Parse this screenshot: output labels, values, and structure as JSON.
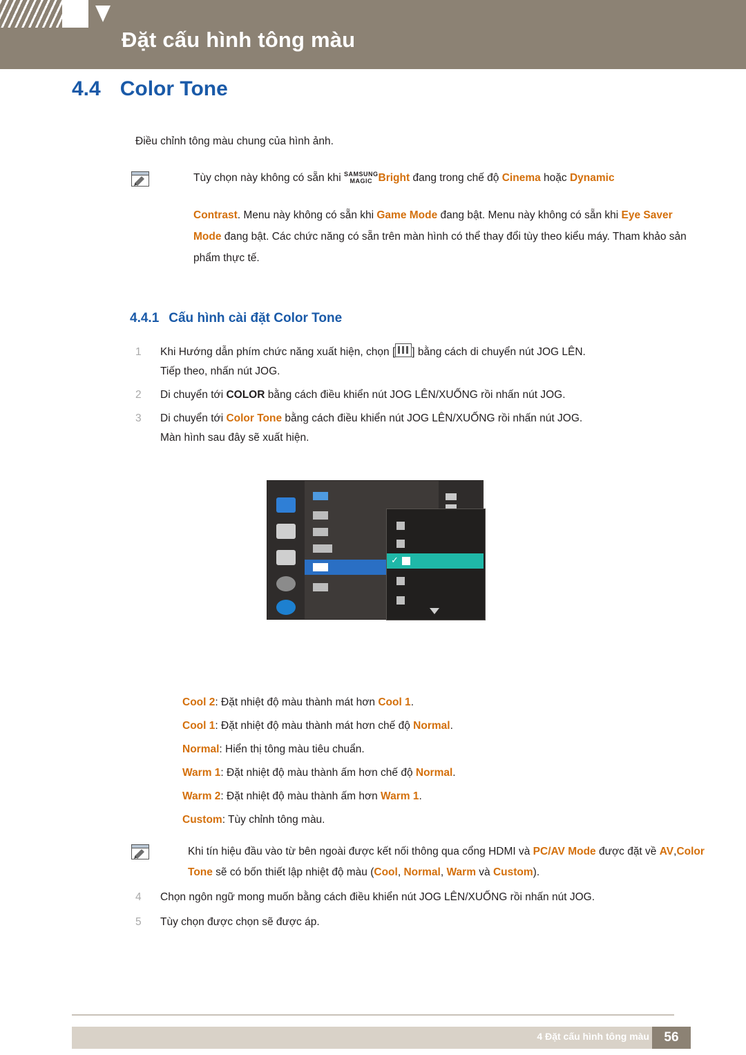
{
  "header": {
    "title": "Đặt cấu hình tông màu"
  },
  "section": {
    "number": "4.4",
    "title": "Color Tone",
    "intro": "Điều chỉnh tông màu chung của hình ảnh."
  },
  "note1": {
    "icon": "note-pencil-icon",
    "line1_a": "Tùy chọn này không có sẵn khi ",
    "magic_top": "SAMSUNG",
    "magic_bottom": "MAGIC",
    "line1_bright": "Bright",
    "line1_b": " đang trong chế độ ",
    "line1_cinema": "Cinema",
    "line1_c": " hoặc ",
    "line1_dynamic": "Dynamic",
    "line1_contrast": "Contrast",
    "line1_d": ".",
    "line2_a": "Menu này không có sẵn khi ",
    "line2_game": "Game Mode",
    "line2_b": " đang bật.",
    "line3_a": "Menu này không có sẵn khi ",
    "line3_eye": "Eye Saver Mode",
    "line3_b": " đang bật.",
    "line4": "Các chức năng có sẵn trên màn hình có thể thay đổi tùy theo kiểu máy. Tham khảo sản phẩm thực tế."
  },
  "subsection": {
    "number": "4.4.1",
    "title": "Cấu hình cài đặt Color Tone"
  },
  "steps": [
    {
      "marker": "1",
      "text_a": "Khi Hướng dẫn phím chức năng xuất hiện, chọn [",
      "icon": "jog-menu-icon",
      "text_b": "] bằng cách di chuyển nút JOG LÊN.",
      "text_c": "Tiếp theo, nhấn nút JOG."
    },
    {
      "marker": "2",
      "text_a": "Di chuyển tới ",
      "bold": "COLOR",
      "text_b": " bằng cách điều khiển nút JOG LÊN/XUỐNG rồi nhấn nút JOG."
    },
    {
      "marker": "3",
      "text_a": "Di chuyển tới ",
      "bold": "Color Tone",
      "text_b": " bằng cách điều khiển nút JOG LÊN/XUỐNG rồi nhấn nút JOG.",
      "text_c": "Màn hình sau đây sẽ xuất hiện."
    }
  ],
  "osd": {
    "name": "on-screen-display-menu-image"
  },
  "options": [
    {
      "label": "Cool 2",
      "sep": ": ",
      "text_a": "Đặt nhiệt độ màu thành mát hơn ",
      "ref": "Cool 1",
      "text_b": "."
    },
    {
      "label": "Cool 1",
      "sep": ": ",
      "text_a": "Đặt nhiệt độ màu thành mát hơn chế độ ",
      "ref": "Normal",
      "text_b": "."
    },
    {
      "label": "Normal",
      "sep": ": ",
      "text_a": "Hiển thị tông màu tiêu chuẩn.",
      "ref": "",
      "text_b": ""
    },
    {
      "label": "Warm 1",
      "sep": ": ",
      "text_a": "Đặt nhiệt độ màu thành ấm hơn chế độ ",
      "ref": "Normal",
      "text_b": "."
    },
    {
      "label": "Warm 2",
      "sep": ": ",
      "text_a": "Đặt nhiệt độ màu thành ấm hơn ",
      "ref": "Warm 1",
      "text_b": "."
    },
    {
      "label": "Custom",
      "sep": ": ",
      "text_a": "Tùy chỉnh tông màu.",
      "ref": "",
      "text_b": ""
    }
  ],
  "note2": {
    "icon": "note-pencil-icon",
    "a": "Khi tín hiệu đầu vào từ bên ngoài được kết nối thông qua cổng HDMI và ",
    "pcav": "PC/AV Mode",
    "b": " được đặt về ",
    "av": "AV",
    "comma1": ",",
    "colortone": "Color Tone",
    "c": " sẽ có bốn thiết lập nhiệt độ màu (",
    "cool": "Cool",
    "comma2": ", ",
    "normal": "Normal",
    "comma3": ", ",
    "warm": "Warm",
    "d": " và ",
    "custom": "Custom",
    "e": ")."
  },
  "steps2": [
    {
      "marker": "4",
      "text": "Chọn ngôn ngữ mong muốn bằng cách điều khiển nút JOG LÊN/XUỐNG rồi nhấn nút JOG."
    },
    {
      "marker": "5",
      "text": "Tùy chọn được chọn sẽ được áp."
    }
  ],
  "footer": {
    "text": "4 Đặt cấu hình tông màu",
    "page": "56"
  },
  "colors": {
    "header_band": "#8c8274",
    "heading_blue": "#1a5aa8",
    "accent_orange": "#d4700c",
    "footer_bar": "#d9d2c8"
  }
}
